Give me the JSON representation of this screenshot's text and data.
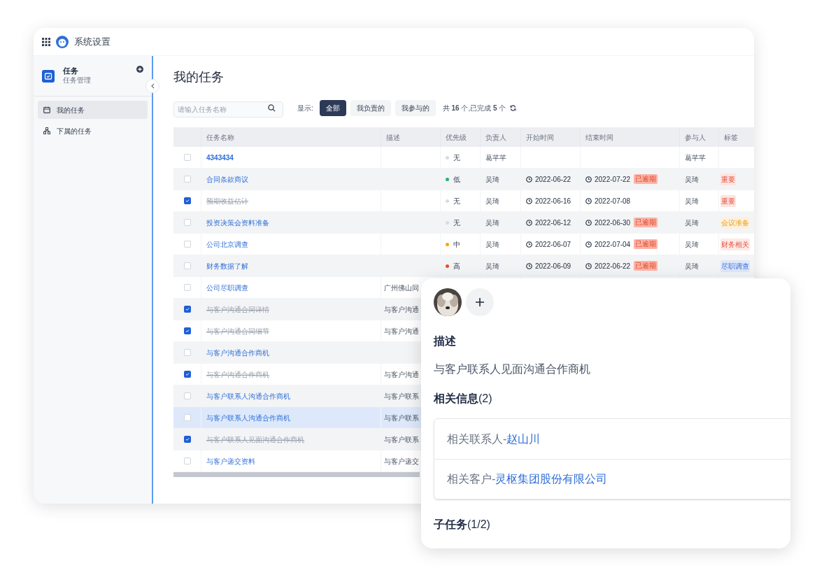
{
  "header": {
    "title": "系统设置"
  },
  "sidebar": {
    "title": "任务",
    "subtitle": "任务管理",
    "items": [
      {
        "label": "我的任务",
        "selected": true,
        "kind": "calendar"
      },
      {
        "label": "下属的任务",
        "selected": false,
        "kind": "tree"
      }
    ]
  },
  "page": {
    "title": "我的任务"
  },
  "search": {
    "placeholder": "请输入任务名称"
  },
  "filter": {
    "label": "显示:",
    "options": [
      {
        "label": "全部",
        "selected": true
      },
      {
        "label": "我负责的",
        "selected": false
      },
      {
        "label": "我参与的",
        "selected": false
      }
    ],
    "summary": "共 **16** 个,已完成 **5** 个"
  },
  "table": {
    "columns": [
      "任务名称",
      "描述",
      "优先级",
      "负责人",
      "开始时间",
      "结束时间",
      "参与人",
      "标签"
    ],
    "rows": [
      {
        "name": "4343434",
        "done": false,
        "selected": false,
        "priority": {
          "label": "无",
          "color": "#d9dbe0"
        },
        "owner": "葛芊芊",
        "participant": "葛芊芊"
      },
      {
        "name": "合同条款商议",
        "done": false,
        "selected": false,
        "priority": {
          "label": "低",
          "color": "#22b573"
        },
        "owner": "吴琦",
        "start": "2022-06-22",
        "end": "2022-07-22",
        "badge": "已逾期",
        "participant": "吴琦",
        "tags": [
          {
            "label": "重要",
            "kind": "important"
          }
        ]
      },
      {
        "name": "预期收益估计",
        "done": true,
        "selected": false,
        "priority": {
          "label": "无",
          "color": "#d9dbe0"
        },
        "owner": "吴琦",
        "start": "2022-06-16",
        "end": "2022-07-08",
        "participant": "吴琦",
        "tags": [
          {
            "label": "重要",
            "kind": "important"
          }
        ]
      },
      {
        "name": "投资决策会资料准备",
        "done": false,
        "selected": false,
        "priority": {
          "label": "无",
          "color": "#d9dbe0"
        },
        "owner": "吴琦",
        "start": "2022-06-12",
        "end": "2022-06-30",
        "badge": "已逾期",
        "participant": "吴琦",
        "tags": [
          {
            "label": "会议准备",
            "kind": "meeting"
          }
        ]
      },
      {
        "name": "公司北京调查",
        "done": false,
        "selected": false,
        "priority": {
          "label": "中",
          "color": "#ffa500"
        },
        "owner": "吴琦",
        "start": "2022-06-07",
        "end": "2022-07-04",
        "badge": "已逾期",
        "participant": "吴琦",
        "tags": [
          {
            "label": "财务相关",
            "kind": "finance"
          }
        ]
      },
      {
        "name": "财务数据了解",
        "done": false,
        "selected": false,
        "priority": {
          "label": "高",
          "color": "#f04a2f"
        },
        "owner": "吴琦",
        "start": "2022-06-09",
        "end": "2022-06-22",
        "badge": "已逾期",
        "participant": "吴琦",
        "tags": [
          {
            "label": "尽职调查",
            "kind": "diligence"
          }
        ]
      },
      {
        "name": "公司尽职调查",
        "done": false,
        "selected": false,
        "desc": "广州佛山同"
      },
      {
        "name": "与客户沟通合同详情",
        "done": true,
        "selected": false,
        "desc": "与客户沟通"
      },
      {
        "name": "与客户沟通合同细节",
        "done": true,
        "selected": false,
        "desc": "与客户沟通"
      },
      {
        "name": "与客户沟通合作商机",
        "done": false,
        "selected": false
      },
      {
        "name": "与客户沟通合作商机",
        "done": true,
        "selected": false,
        "desc": "与客户沟通"
      },
      {
        "name": "与客户联系人沟通合作商机",
        "done": false,
        "selected": false,
        "desc": "与客户联系"
      },
      {
        "name": "与客户联系人沟通合作商机",
        "done": false,
        "selected": true,
        "desc": "与客户联系"
      },
      {
        "name": "与客户联系人见面沟通合作商机",
        "done": true,
        "selected": false,
        "desc": "与客户联系"
      },
      {
        "name": "与客户递交资料",
        "done": false,
        "selected": false,
        "desc": "与客户递交"
      }
    ]
  },
  "detail": {
    "description_title": "描述",
    "description": "与客户联系人见面沟通合作商机",
    "related_title": "**相关信息**(2)",
    "related": [
      {
        "label": "相关联系人-",
        "value": "赵山川"
      },
      {
        "label": "相关客户-",
        "value": "灵枢集团股份有限公司"
      }
    ],
    "subtasks_title": "**子任务**(1/2)"
  }
}
